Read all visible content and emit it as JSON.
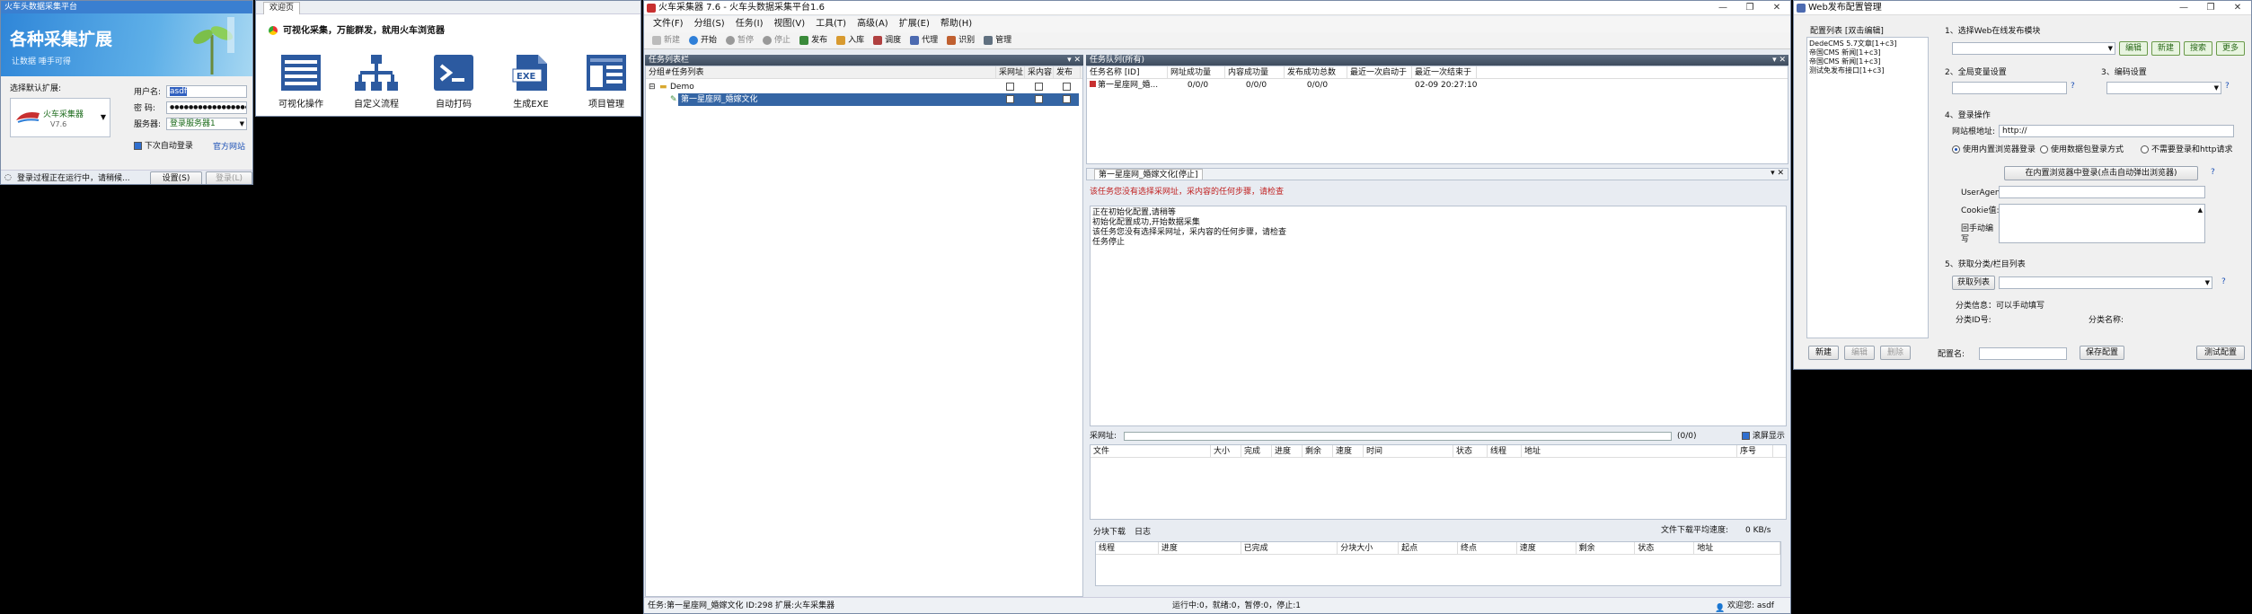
{
  "login": {
    "title": "火车头数据采集平台",
    "banner_title": "各种采集扩展",
    "banner_sub": "让数据 唾手可得",
    "select_label": "选择默认扩展:",
    "product_name": "火车采集器",
    "product_version": "V7.6",
    "username_label": "用户名:",
    "username_value": "asdf",
    "password_label": "密  码:",
    "password_value": "●●●●●●●●●●●●●●●●●●",
    "server_label": "服务器:",
    "server_value": "登录服务器1",
    "auto_login_label": "下次自动登录",
    "official_link": "官方网站",
    "status_text": "登录过程正在运行中，请稍候...",
    "settings_btn": "设置(S)",
    "login_btn": "登录(L)"
  },
  "welcome": {
    "tab": "欢迎页",
    "slogan": "可视化采集，万能群发，就用火车浏览器",
    "items": [
      {
        "label": "可视化操作"
      },
      {
        "label": "自定义流程"
      },
      {
        "label": "自动打码"
      },
      {
        "label": "生成EXE"
      },
      {
        "label": "项目管理"
      }
    ]
  },
  "main": {
    "title": "火车采集器 7.6 - 火车头数据采集平台1.6",
    "menu": [
      "文件(F)",
      "分组(S)",
      "任务(I)",
      "视图(V)",
      "工具(T)",
      "高级(A)",
      "扩展(E)",
      "帮助(H)"
    ],
    "toolbar": [
      {
        "label": "新建",
        "color": "#bbbbbb"
      },
      {
        "label": "开始",
        "color": "#2f7fd8"
      },
      {
        "label": "暂停",
        "color": "#999999"
      },
      {
        "label": "停止",
        "color": "#999999"
      },
      {
        "label": "发布",
        "color": "#3a8a3a"
      },
      {
        "label": "入库",
        "color": "#d89a2f"
      },
      {
        "label": "调度",
        "color": "#b04040"
      },
      {
        "label": "代理",
        "color": "#4c6ab0"
      },
      {
        "label": "识别",
        "color": "#c06030"
      },
      {
        "label": "管理",
        "color": "#607080"
      }
    ],
    "task_panel_title": "任务列表栏",
    "task_cols": [
      "分组#任务列表",
      "采网址",
      "采内容",
      "发布"
    ],
    "task_group": "Demo",
    "task_item": "第一星座网_婚嫁文化",
    "queue_panel_title": "任务队列(所有)",
    "queue_cols": [
      "任务名称 [ID]",
      "网址成功量",
      "内容成功量",
      "发布成功总数",
      "最近一次启动于",
      "最近一次结束于"
    ],
    "queue_row": [
      "第一星座网_婚...",
      "0/0/0",
      "0/0/0",
      "0/0/0",
      "",
      "02-09 20:27:10"
    ],
    "log_panel_title": "第一星座网_婚嫁文化[停止]",
    "warning": "该任务您没有选择采网址，采内容的任何步骤，请检查",
    "log_lines": [
      "正在初始化配置,请稍等",
      "初始化配置成功,开始数据采集",
      "该任务您没有选择采网址，采内容的任何步骤，请检查",
      "任务停止"
    ],
    "url_label": "采网址:",
    "url_progress": "(0/0)",
    "scroll_label": "滚屏显示",
    "file_cols": [
      "文件",
      "大小",
      "完成",
      "进度",
      "剩余",
      "速度",
      "时间",
      "状态",
      "线程",
      "地址",
      "序号"
    ],
    "tab_download": "分块下载",
    "tab_log": "日志",
    "speed_label": "文件下载平均速度:",
    "speed_value": "0 KB/s",
    "block_cols": [
      "线程",
      "进度",
      "已完成",
      "分块大小",
      "起点",
      "终点",
      "速度",
      "剩余",
      "状态",
      "地址"
    ],
    "status_left": "任务:第一星座网_婚嫁文化  ID:298  扩展:火车采集器",
    "status_mid": "运行中:0，就绪:0，暂停:0，停止:1",
    "status_right": "欢迎您:  asdf"
  },
  "publish": {
    "title": "Web发布配置管理",
    "list_label": "配置列表 [双击编辑]",
    "list_items": [
      "DedeCMS 5.7文章[1+c3]",
      "帝国CMS 新闻[1+c3]",
      "帝国CMS 新闻[1+c3]",
      "测试免发布接口[1+c3]"
    ],
    "section1": "1、选择Web在线发布模块",
    "btn_edit": "编辑",
    "btn_new": "新建",
    "btn_search": "搜索",
    "btn_more": "更多",
    "section2": "2、全局变量设置",
    "section3": "3、编码设置",
    "section4": "4、登录操作",
    "site_label": "网站根地址:",
    "site_value": "http://",
    "radio1": "使用内置浏览器登录",
    "radio2": "使用数据包登录方式",
    "radio3": "不需要登录和http请求",
    "browser_btn": "在内置浏览器中登录(点击自动弹出浏览器)",
    "ua_label": "UserAgent",
    "cookie_label": "Cookie值:",
    "return_label": "回手动编写",
    "section5": "5、获取分类/栏目列表",
    "get_list_btn": "获取列表",
    "cat_info": "分类信息：可以手动填写",
    "cat_id": "分类ID号:",
    "cat_name": "分类名称:",
    "btn_create": "新建",
    "btn_edit2": "编辑",
    "btn_delete": "删除",
    "config_name_label": "配置名:",
    "save_btn": "保存配置",
    "test_btn": "测试配置"
  }
}
